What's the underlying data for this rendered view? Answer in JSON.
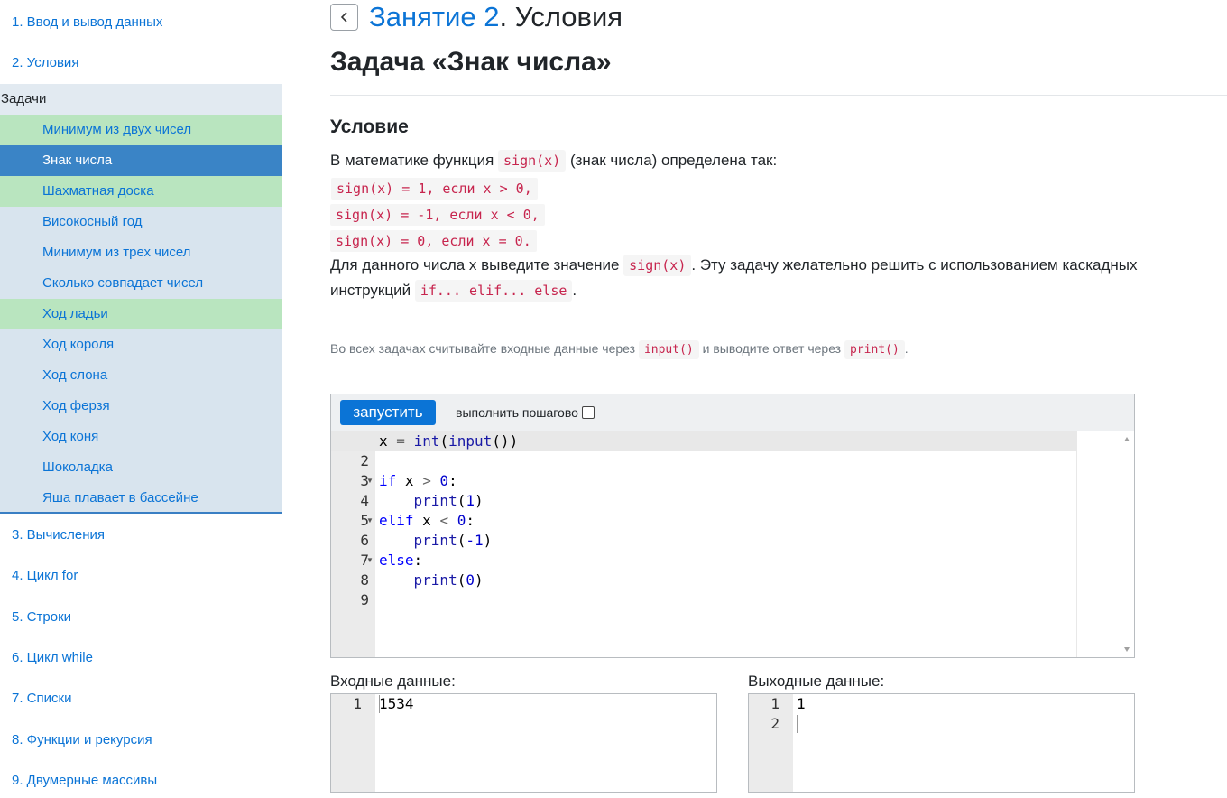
{
  "sidebar": {
    "lessons_top": [
      "1. Ввод и вывод данных",
      "2. Условия"
    ],
    "tasks_header": "Задачи",
    "tasks": [
      {
        "label": "Минимум из двух чисел",
        "state": "solved"
      },
      {
        "label": "Знак числа",
        "state": "active"
      },
      {
        "label": "Шахматная доска",
        "state": "solved"
      },
      {
        "label": "Високосный год",
        "state": "none"
      },
      {
        "label": "Минимум из трех чисел",
        "state": "none"
      },
      {
        "label": "Сколько совпадает чисел",
        "state": "none"
      },
      {
        "label": "Ход ладьи",
        "state": "solved"
      },
      {
        "label": "Ход короля",
        "state": "none"
      },
      {
        "label": "Ход слона",
        "state": "none"
      },
      {
        "label": "Ход ферзя",
        "state": "none"
      },
      {
        "label": "Ход коня",
        "state": "none"
      },
      {
        "label": "Шоколадка",
        "state": "none"
      },
      {
        "label": "Яша плавает в бассейне",
        "state": "none"
      }
    ],
    "lessons_bottom": [
      "3. Вычисления",
      "4. Цикл for",
      "5. Строки",
      "6. Цикл while",
      "7. Списки",
      "8. Функции и рекурсия",
      "9. Двумерные массивы"
    ]
  },
  "header": {
    "lesson_link": "Занятие 2",
    "lesson_rest": ". Условия",
    "task_title": "Задача «Знак числа»"
  },
  "condition": {
    "heading": "Условие",
    "p1_before": "В математике функция ",
    "p1_code": "sign(x)",
    "p1_after": " (знак числа) определена так:",
    "formula_lines": [
      "sign(x) = 1, если x > 0,",
      "sign(x) = -1, если x < 0,",
      "sign(x) = 0, если x = 0."
    ],
    "p2_before": "Для данного числа x выведите значение ",
    "p2_code": "sign(x)",
    "p2_after": ". Эту задачу желательно решить с использованием каскадных",
    "p3_before": "инструкций ",
    "p3_code": "if... elif... else",
    "p3_after": "."
  },
  "note": {
    "before": "Во всех задачах считывайте входные данные через ",
    "code1": "input()",
    "middle": " и выводите ответ через ",
    "code2": "print()",
    "after": "."
  },
  "editor": {
    "run_label": "запустить",
    "step_label": "выполнить пошагово",
    "step_checked": false,
    "line_numbers": [
      "1",
      "2",
      "3",
      "4",
      "5",
      "6",
      "7",
      "8",
      "9"
    ],
    "fold_lines": [
      3,
      5,
      7
    ],
    "code_lines": [
      "x = int(input())",
      "",
      "if x > 0:",
      "    print(1)",
      "elif x < 0:",
      "    print(-1)",
      "else:",
      "    print(0)",
      ""
    ]
  },
  "io": {
    "input_label": "Входные данные:",
    "output_label": "Выходные данные:",
    "input_lines": [
      "1534"
    ],
    "output_lines": [
      "1",
      ""
    ]
  },
  "colors": {
    "accent": "#0b74d6",
    "solved": "#b9e5bf",
    "active": "#3a84c6",
    "inline_code": "#c7254e"
  }
}
